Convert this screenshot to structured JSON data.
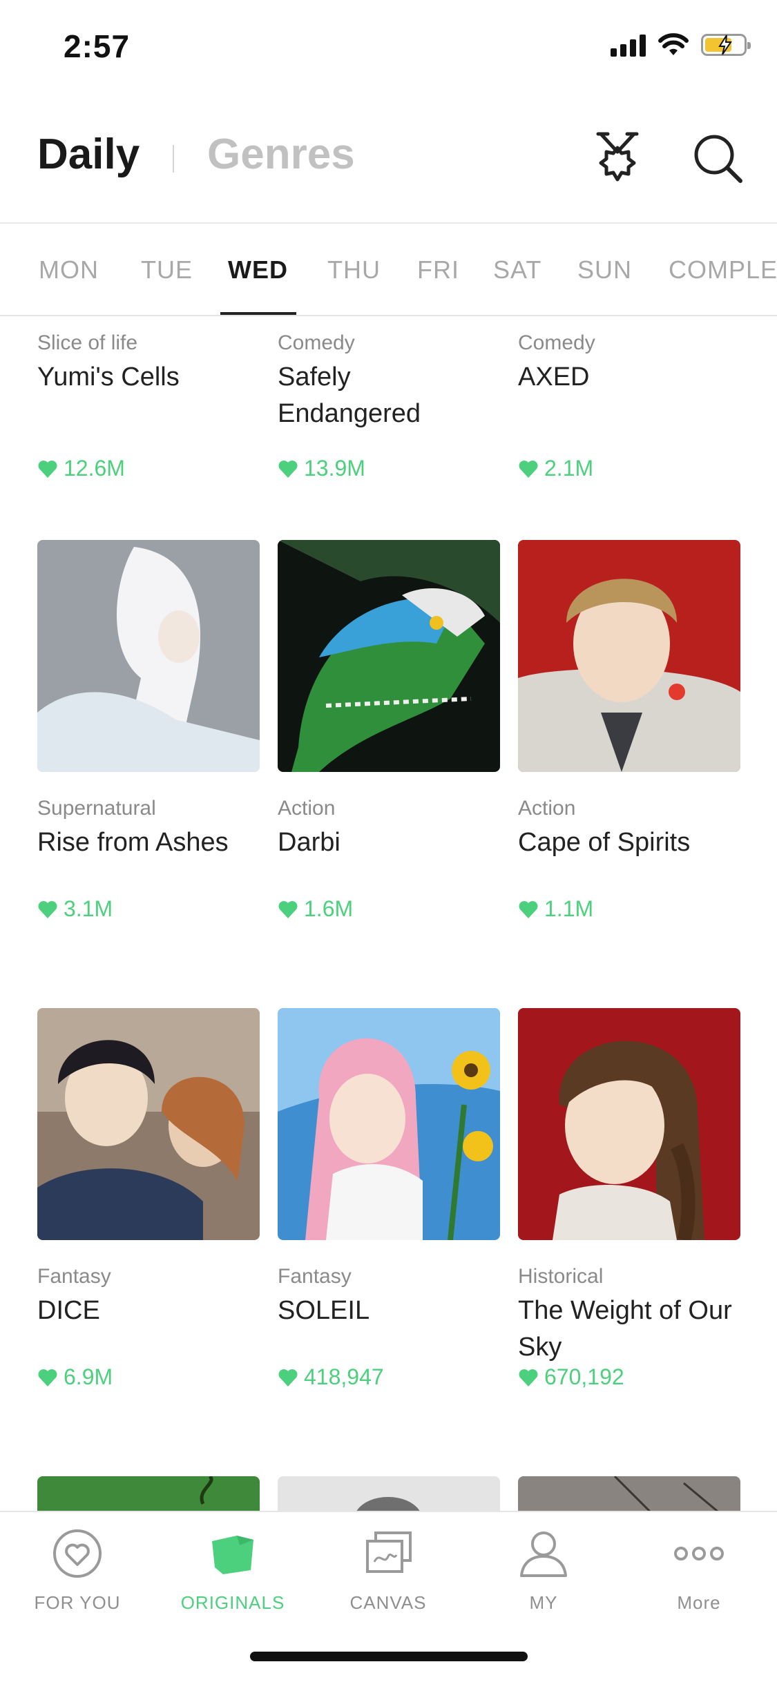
{
  "status_bar": {
    "time": "2:57"
  },
  "header": {
    "tab_daily": "Daily",
    "tab_genres": "Genres"
  },
  "day_tabs": [
    "MON",
    "TUE",
    "WED",
    "THU",
    "FRI",
    "SAT",
    "SUN",
    "COMPLETED"
  ],
  "active_day": "WED",
  "comics": [
    {
      "genre": "Slice of life",
      "title": "Yumi's Cells",
      "likes": "12.6M"
    },
    {
      "genre": "Comedy",
      "title": "Safely Endangered",
      "likes": "13.9M"
    },
    {
      "genre": "Comedy",
      "title": "AXED",
      "likes": "2.1M"
    },
    {
      "genre": "Supernatural",
      "title": "Rise from Ashes",
      "likes": "3.1M"
    },
    {
      "genre": "Action",
      "title": "Darbi",
      "likes": "1.6M"
    },
    {
      "genre": "Action",
      "title": "Cape of Spirits",
      "likes": "1.1M"
    },
    {
      "genre": "Fantasy",
      "title": "DICE",
      "likes": "6.9M"
    },
    {
      "genre": "Fantasy",
      "title": "SOLEIL",
      "likes": "418,947"
    },
    {
      "genre": "Historical",
      "title": "The Weight of Our Sky",
      "likes": "670,192"
    }
  ],
  "bottom_nav": [
    {
      "label": "FOR YOU",
      "icon": "heart-circle-icon"
    },
    {
      "label": "ORIGINALS",
      "icon": "originals-icon"
    },
    {
      "label": "CANVAS",
      "icon": "canvas-icon"
    },
    {
      "label": "MY",
      "icon": "person-icon"
    },
    {
      "label": "More",
      "icon": "more-icon"
    }
  ],
  "colors": {
    "accent": "#4cd07d",
    "inactive": "#a8a8a8"
  }
}
